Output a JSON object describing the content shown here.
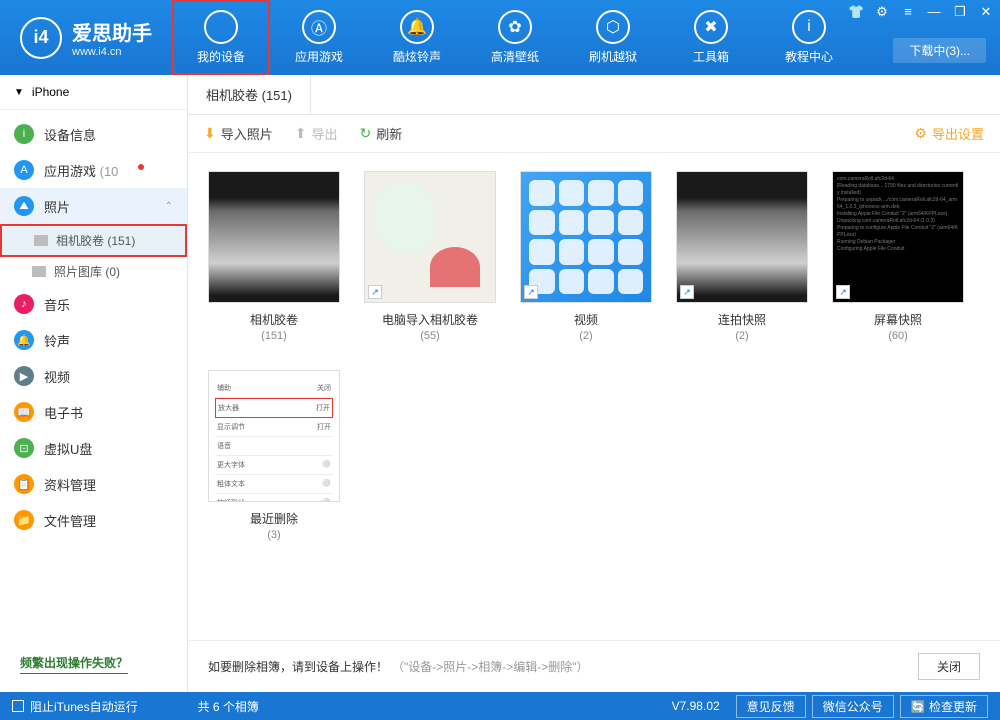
{
  "app": {
    "name": "爱思助手",
    "url": "www.i4.cn",
    "logo_text": "i4"
  },
  "win_controls": {
    "shirt": "👕",
    "gear": "⚙",
    "menu": "≡",
    "min": "—",
    "max": "❐",
    "close": "✕"
  },
  "download_box": "下载中(3)...",
  "nav": [
    {
      "label": "我的设备",
      "glyph": ""
    },
    {
      "label": "应用游戏",
      "glyph": "Ⓐ"
    },
    {
      "label": "酷炫铃声",
      "glyph": "🔔"
    },
    {
      "label": "高清壁纸",
      "glyph": "✿"
    },
    {
      "label": "刷机越狱",
      "glyph": "⬡"
    },
    {
      "label": "工具箱",
      "glyph": "✖"
    },
    {
      "label": "教程中心",
      "glyph": "i"
    }
  ],
  "sidebar": {
    "device": "iPhone",
    "items": [
      {
        "label": "设备信息",
        "color": "#4caf50",
        "glyph": "i"
      },
      {
        "label": "应用游戏",
        "badge": "(10",
        "color": "#2196f3",
        "glyph": "A"
      },
      {
        "label": "照片",
        "color": "#2196f3",
        "glyph": "⛰"
      },
      {
        "label": "音乐",
        "color": "#e91e63",
        "glyph": "♪"
      },
      {
        "label": "铃声",
        "color": "#2196f3",
        "glyph": "🔔"
      },
      {
        "label": "视频",
        "color": "#607d8b",
        "glyph": "▶"
      },
      {
        "label": "电子书",
        "color": "#ff9800",
        "glyph": "📖"
      },
      {
        "label": "虚拟U盘",
        "color": "#4caf50",
        "glyph": "⊡"
      },
      {
        "label": "资料管理",
        "color": "#ff9800",
        "glyph": "📋"
      },
      {
        "label": "文件管理",
        "color": "#ff9800",
        "glyph": "📁"
      }
    ],
    "photo_subs": [
      {
        "label": "相机胶卷",
        "count": "(151)",
        "hl": true
      },
      {
        "label": "照片图库",
        "count": "(0)",
        "hl": false
      }
    ],
    "help": "频繁出现操作失败？"
  },
  "tab": {
    "label": "相机胶卷 (151)"
  },
  "toolbar": {
    "import": "导入照片",
    "export": "导出",
    "refresh": "刷新",
    "settings": "导出设置"
  },
  "albums": [
    {
      "name": "相机胶卷",
      "count": "(151)",
      "thumb": "th1",
      "shortcut": false
    },
    {
      "name": "电脑导入相机胶卷",
      "count": "(55)",
      "thumb": "th2",
      "shortcut": true
    },
    {
      "name": "视频",
      "count": "(2)",
      "thumb": "th3",
      "shortcut": true
    },
    {
      "name": "连拍快照",
      "count": "(2)",
      "thumb": "th4",
      "shortcut": true
    },
    {
      "name": "屏幕快照",
      "count": "(60)",
      "thumb": "th5",
      "shortcut": true
    },
    {
      "name": "最近删除",
      "count": "(3)",
      "thumb": "th6",
      "shortcut": false
    }
  ],
  "footer": {
    "text": "如要删除相簿，请到设备上操作！",
    "hint": "（\"设备->照片->相簿->编辑->删除\"）",
    "close": "关闭"
  },
  "status": {
    "block_itunes": "阻止iTunes自动运行",
    "album_count": "共 6 个相簿",
    "version": "V7.98.02",
    "feedback": "意见反馈",
    "wechat": "微信公众号",
    "update": "检查更新"
  }
}
